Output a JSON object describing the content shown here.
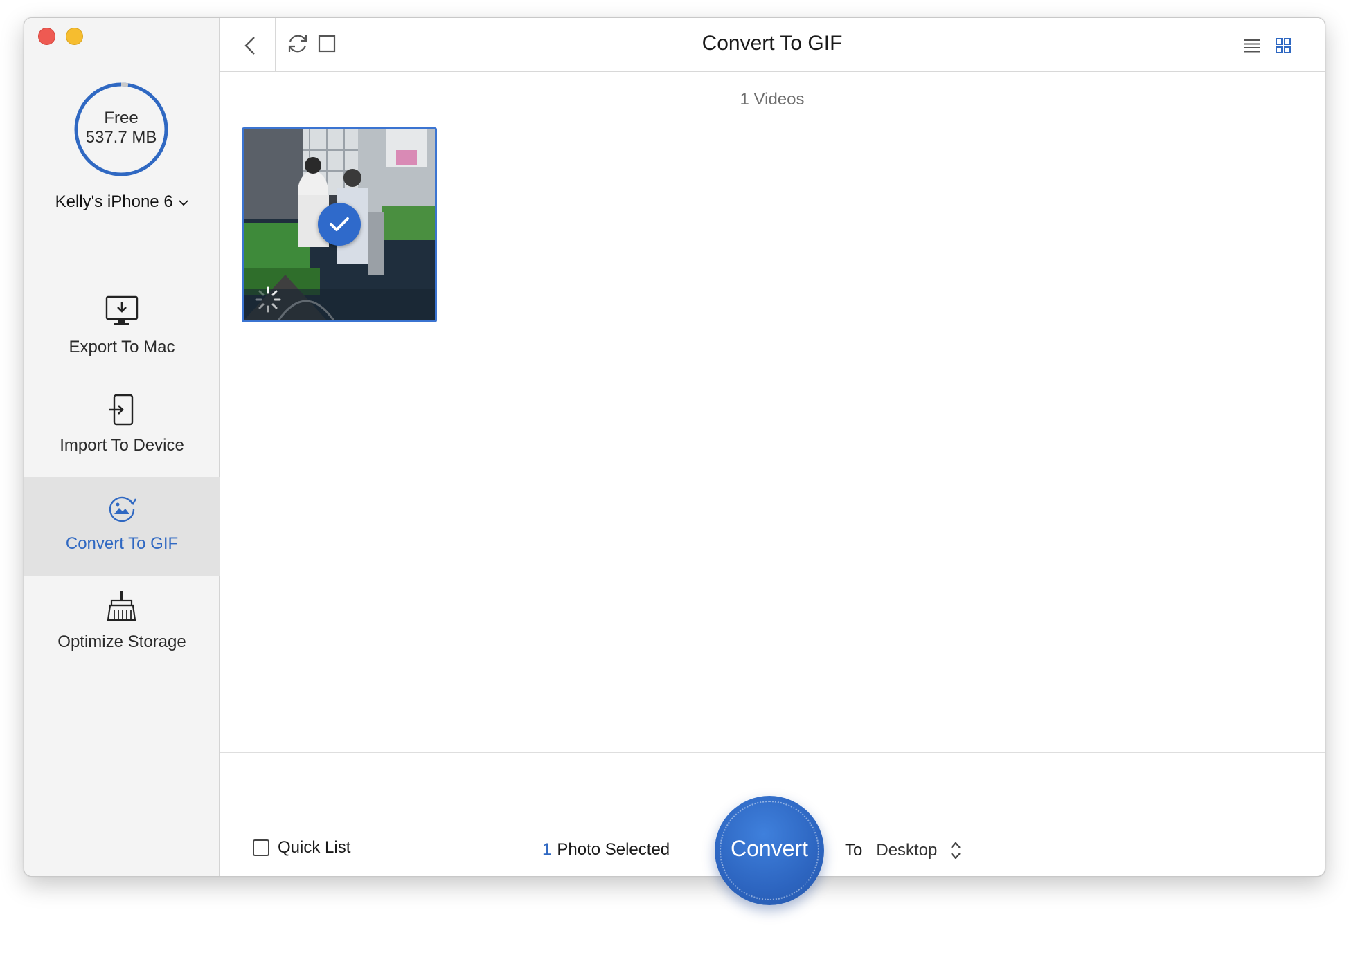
{
  "sidebar": {
    "storage": {
      "label": "Free",
      "value": "537.7 MB"
    },
    "device_name": "Kelly's iPhone 6",
    "items": [
      {
        "label": "Export To Mac",
        "icon": "monitor-download-icon",
        "active": false
      },
      {
        "label": "Import To Device",
        "icon": "phone-import-icon",
        "active": false
      },
      {
        "label": "Convert To GIF",
        "icon": "gif-convert-icon",
        "active": true
      },
      {
        "label": "Optimize Storage",
        "icon": "broom-icon",
        "active": false
      }
    ]
  },
  "toolbar": {
    "title": "Convert To GIF",
    "icons": [
      "back-icon",
      "refresh-icon",
      "select-all-icon",
      "list-view-icon",
      "grid-view-icon"
    ]
  },
  "content": {
    "count_label": "1 Videos",
    "items": [
      {
        "type": "video",
        "selected": true
      }
    ]
  },
  "footer": {
    "quick_list_label": "Quick List",
    "selected_count": "1",
    "selected_text": "Photo Selected",
    "convert_label": "Convert",
    "to_label": "To",
    "destination": "Desktop"
  },
  "colors": {
    "accent": "#2f68c2",
    "close": "#ee5a52",
    "minimize": "#f6bd2f",
    "sidebar_bg": "#f4f4f4",
    "active_item_bg": "#e2e2e2"
  }
}
